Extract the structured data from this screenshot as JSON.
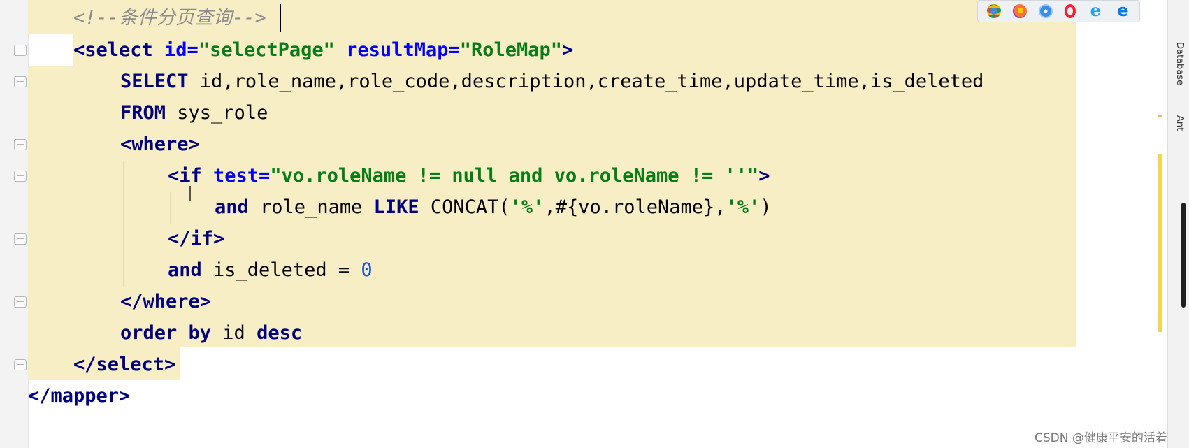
{
  "editor": {
    "lines": [
      {
        "id": "l1",
        "tokens": [
          {
            "t": "<!--条件分页查询-->",
            "c": "comment"
          }
        ]
      },
      {
        "id": "l2",
        "tokens": [
          {
            "t": "<select ",
            "c": "tag"
          },
          {
            "t": "id=",
            "c": "attr"
          },
          {
            "t": "\"selectPage\"",
            "c": "str"
          },
          {
            "t": " resultMap=",
            "c": "attr"
          },
          {
            "t": "\"RoleMap\"",
            "c": "str"
          },
          {
            "t": ">",
            "c": "tag"
          }
        ]
      },
      {
        "id": "l3",
        "tokens": [
          {
            "t": "SELECT",
            "c": "kw"
          },
          {
            "t": " id,role_name,role_code,description,create_time,update_time,is_deleted",
            "c": "plain"
          }
        ]
      },
      {
        "id": "l4",
        "tokens": [
          {
            "t": "FROM",
            "c": "kw"
          },
          {
            "t": " sys_role",
            "c": "plain"
          }
        ]
      },
      {
        "id": "l5",
        "tokens": [
          {
            "t": "<where>",
            "c": "tag"
          }
        ]
      },
      {
        "id": "l6",
        "tokens": [
          {
            "t": "<if ",
            "c": "tag"
          },
          {
            "t": "test=",
            "c": "attr"
          },
          {
            "t": "\"vo.roleName != null and vo.roleName != ''\"",
            "c": "str"
          },
          {
            "t": ">",
            "c": "tag"
          }
        ]
      },
      {
        "id": "l7",
        "tokens": [
          {
            "t": "and",
            "c": "kw"
          },
          {
            "t": " role_name ",
            "c": "plain"
          },
          {
            "t": "LIKE",
            "c": "kw"
          },
          {
            "t": " CONCAT(",
            "c": "plain"
          },
          {
            "t": "'%'",
            "c": "str"
          },
          {
            "t": ",#{vo.roleName},",
            "c": "plain"
          },
          {
            "t": "'%'",
            "c": "str"
          },
          {
            "t": ")",
            "c": "plain"
          }
        ]
      },
      {
        "id": "l8",
        "tokens": [
          {
            "t": "</if>",
            "c": "tag"
          }
        ]
      },
      {
        "id": "l9",
        "tokens": [
          {
            "t": "and",
            "c": "kw"
          },
          {
            "t": " is_deleted = ",
            "c": "plain"
          },
          {
            "t": "0",
            "c": "num"
          }
        ]
      },
      {
        "id": "l10",
        "tokens": [
          {
            "t": "</where>",
            "c": "tag"
          }
        ]
      },
      {
        "id": "l11",
        "tokens": [
          {
            "t": "order by",
            "c": "kw"
          },
          {
            "t": " id ",
            "c": "plain"
          },
          {
            "t": "desc",
            "c": "kw"
          }
        ]
      },
      {
        "id": "l12",
        "tokens": [
          {
            "t": "</select>",
            "c": "tag"
          }
        ]
      },
      {
        "id": "l13",
        "tokens": [
          {
            "t": "</mapper>",
            "c": "tag"
          }
        ]
      }
    ]
  },
  "browser_icons": [
    "chrome-icon",
    "firefox-icon",
    "safari-icon",
    "opera-icon",
    "ie-icon",
    "edge-icon"
  ],
  "right_panel": {
    "tab1": "Database",
    "tab2": "Ant"
  },
  "watermark": "CSDN @健康平安的活着",
  "colors": {
    "highlight": "#f8eec5",
    "tag": "#000080",
    "attr": "#0000ff",
    "string": "#067d17",
    "comment": "#8c8c8c",
    "number": "#1750eb"
  }
}
